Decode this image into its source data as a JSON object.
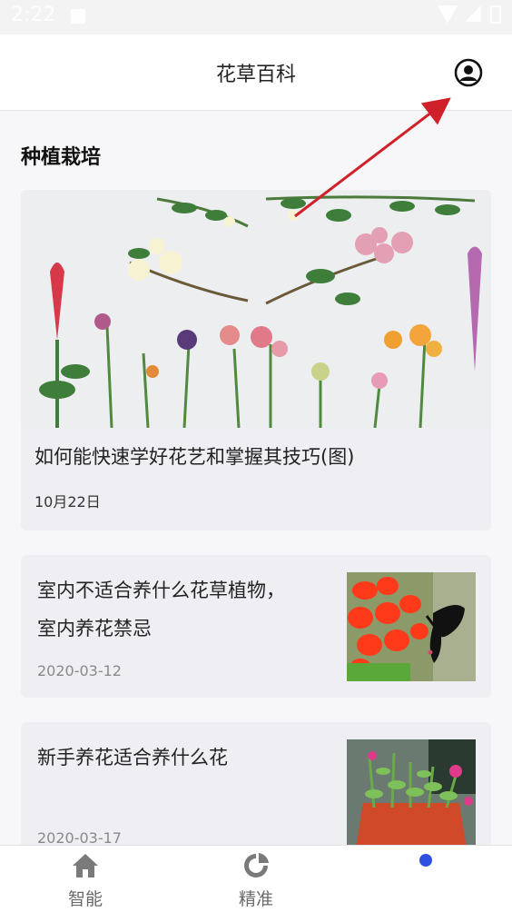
{
  "status_bar": {
    "time": "2:22"
  },
  "app_bar": {
    "title": "花草百科"
  },
  "section": {
    "title": "种植栽培"
  },
  "featured": {
    "title": "如何能快速学好花艺和掌握其技巧(图)",
    "date": "10月22日"
  },
  "articles": [
    {
      "title_line1": "室内不适合养什么花草植物，",
      "title_line2": "室内养花禁忌",
      "date": "2020-03-12"
    },
    {
      "title_line1": "新手养花适合养什么花",
      "date": "2020-03-17"
    }
  ],
  "bottom_nav": {
    "items": [
      {
        "label": "智能",
        "icon": "home-icon"
      },
      {
        "label": "精准",
        "icon": "pie-chart-icon"
      },
      {
        "label": "",
        "icon": "dot-indicator"
      }
    ]
  },
  "colors": {
    "accent": "#2f4fe0",
    "arrow": "#d0202a",
    "card_bg": "#efeff3"
  }
}
